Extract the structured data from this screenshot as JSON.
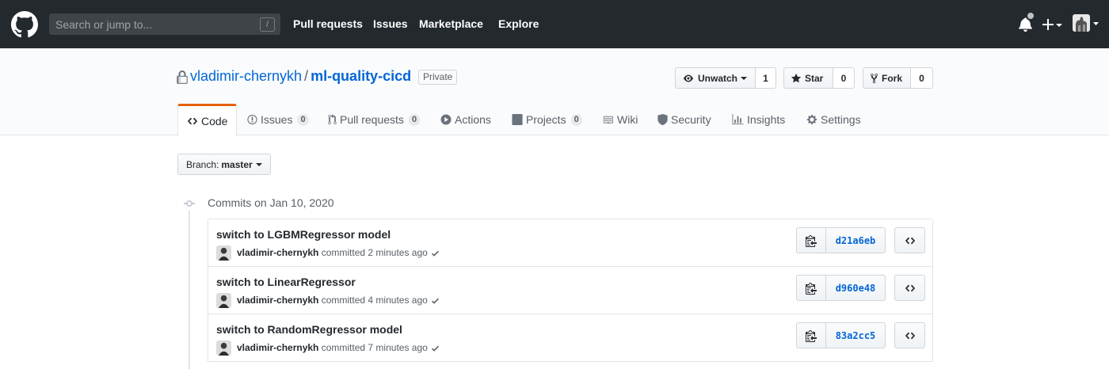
{
  "header": {
    "search_placeholder": "Search or jump to...",
    "search_shortcut": "/",
    "nav": [
      "Pull requests",
      "Issues",
      "Marketplace",
      "Explore"
    ]
  },
  "repo": {
    "owner": "vladimir-chernykh",
    "separator": "/",
    "name": "ml-quality-cicd",
    "visibility": "Private",
    "unwatch_label": "Unwatch",
    "watch_count": "1",
    "star_label": "Star",
    "star_count": "0",
    "fork_label": "Fork",
    "fork_count": "0"
  },
  "tabs": [
    {
      "label": "Code",
      "icon": "code-icon",
      "selected": true
    },
    {
      "label": "Issues",
      "icon": "issue-icon",
      "count": "0"
    },
    {
      "label": "Pull requests",
      "icon": "pull-request-icon",
      "count": "0"
    },
    {
      "label": "Actions",
      "icon": "play-icon"
    },
    {
      "label": "Projects",
      "icon": "project-icon",
      "count": "0"
    },
    {
      "label": "Wiki",
      "icon": "book-icon"
    },
    {
      "label": "Security",
      "icon": "shield-icon"
    },
    {
      "label": "Insights",
      "icon": "graph-icon"
    },
    {
      "label": "Settings",
      "icon": "gear-icon"
    }
  ],
  "branch": {
    "label": "Branch:",
    "value": "master"
  },
  "commits_heading": "Commits on Jan 10, 2020",
  "commits": [
    {
      "title": "switch to LGBMRegressor model",
      "author": "vladimir-chernykh",
      "verb": "committed",
      "time": "2 minutes ago",
      "sha": "d21a6eb"
    },
    {
      "title": "switch to LinearRegressor",
      "author": "vladimir-chernykh",
      "verb": "committed",
      "time": "4 minutes ago",
      "sha": "d960e48"
    },
    {
      "title": "switch to RandomRegressor model",
      "author": "vladimir-chernykh",
      "verb": "committed",
      "time": "7 minutes ago",
      "sha": "83a2cc5"
    }
  ],
  "colors": {
    "header_bg": "#24292e",
    "link": "#0366d6",
    "tab_accent": "#e36209",
    "status_success": "#28a745"
  }
}
